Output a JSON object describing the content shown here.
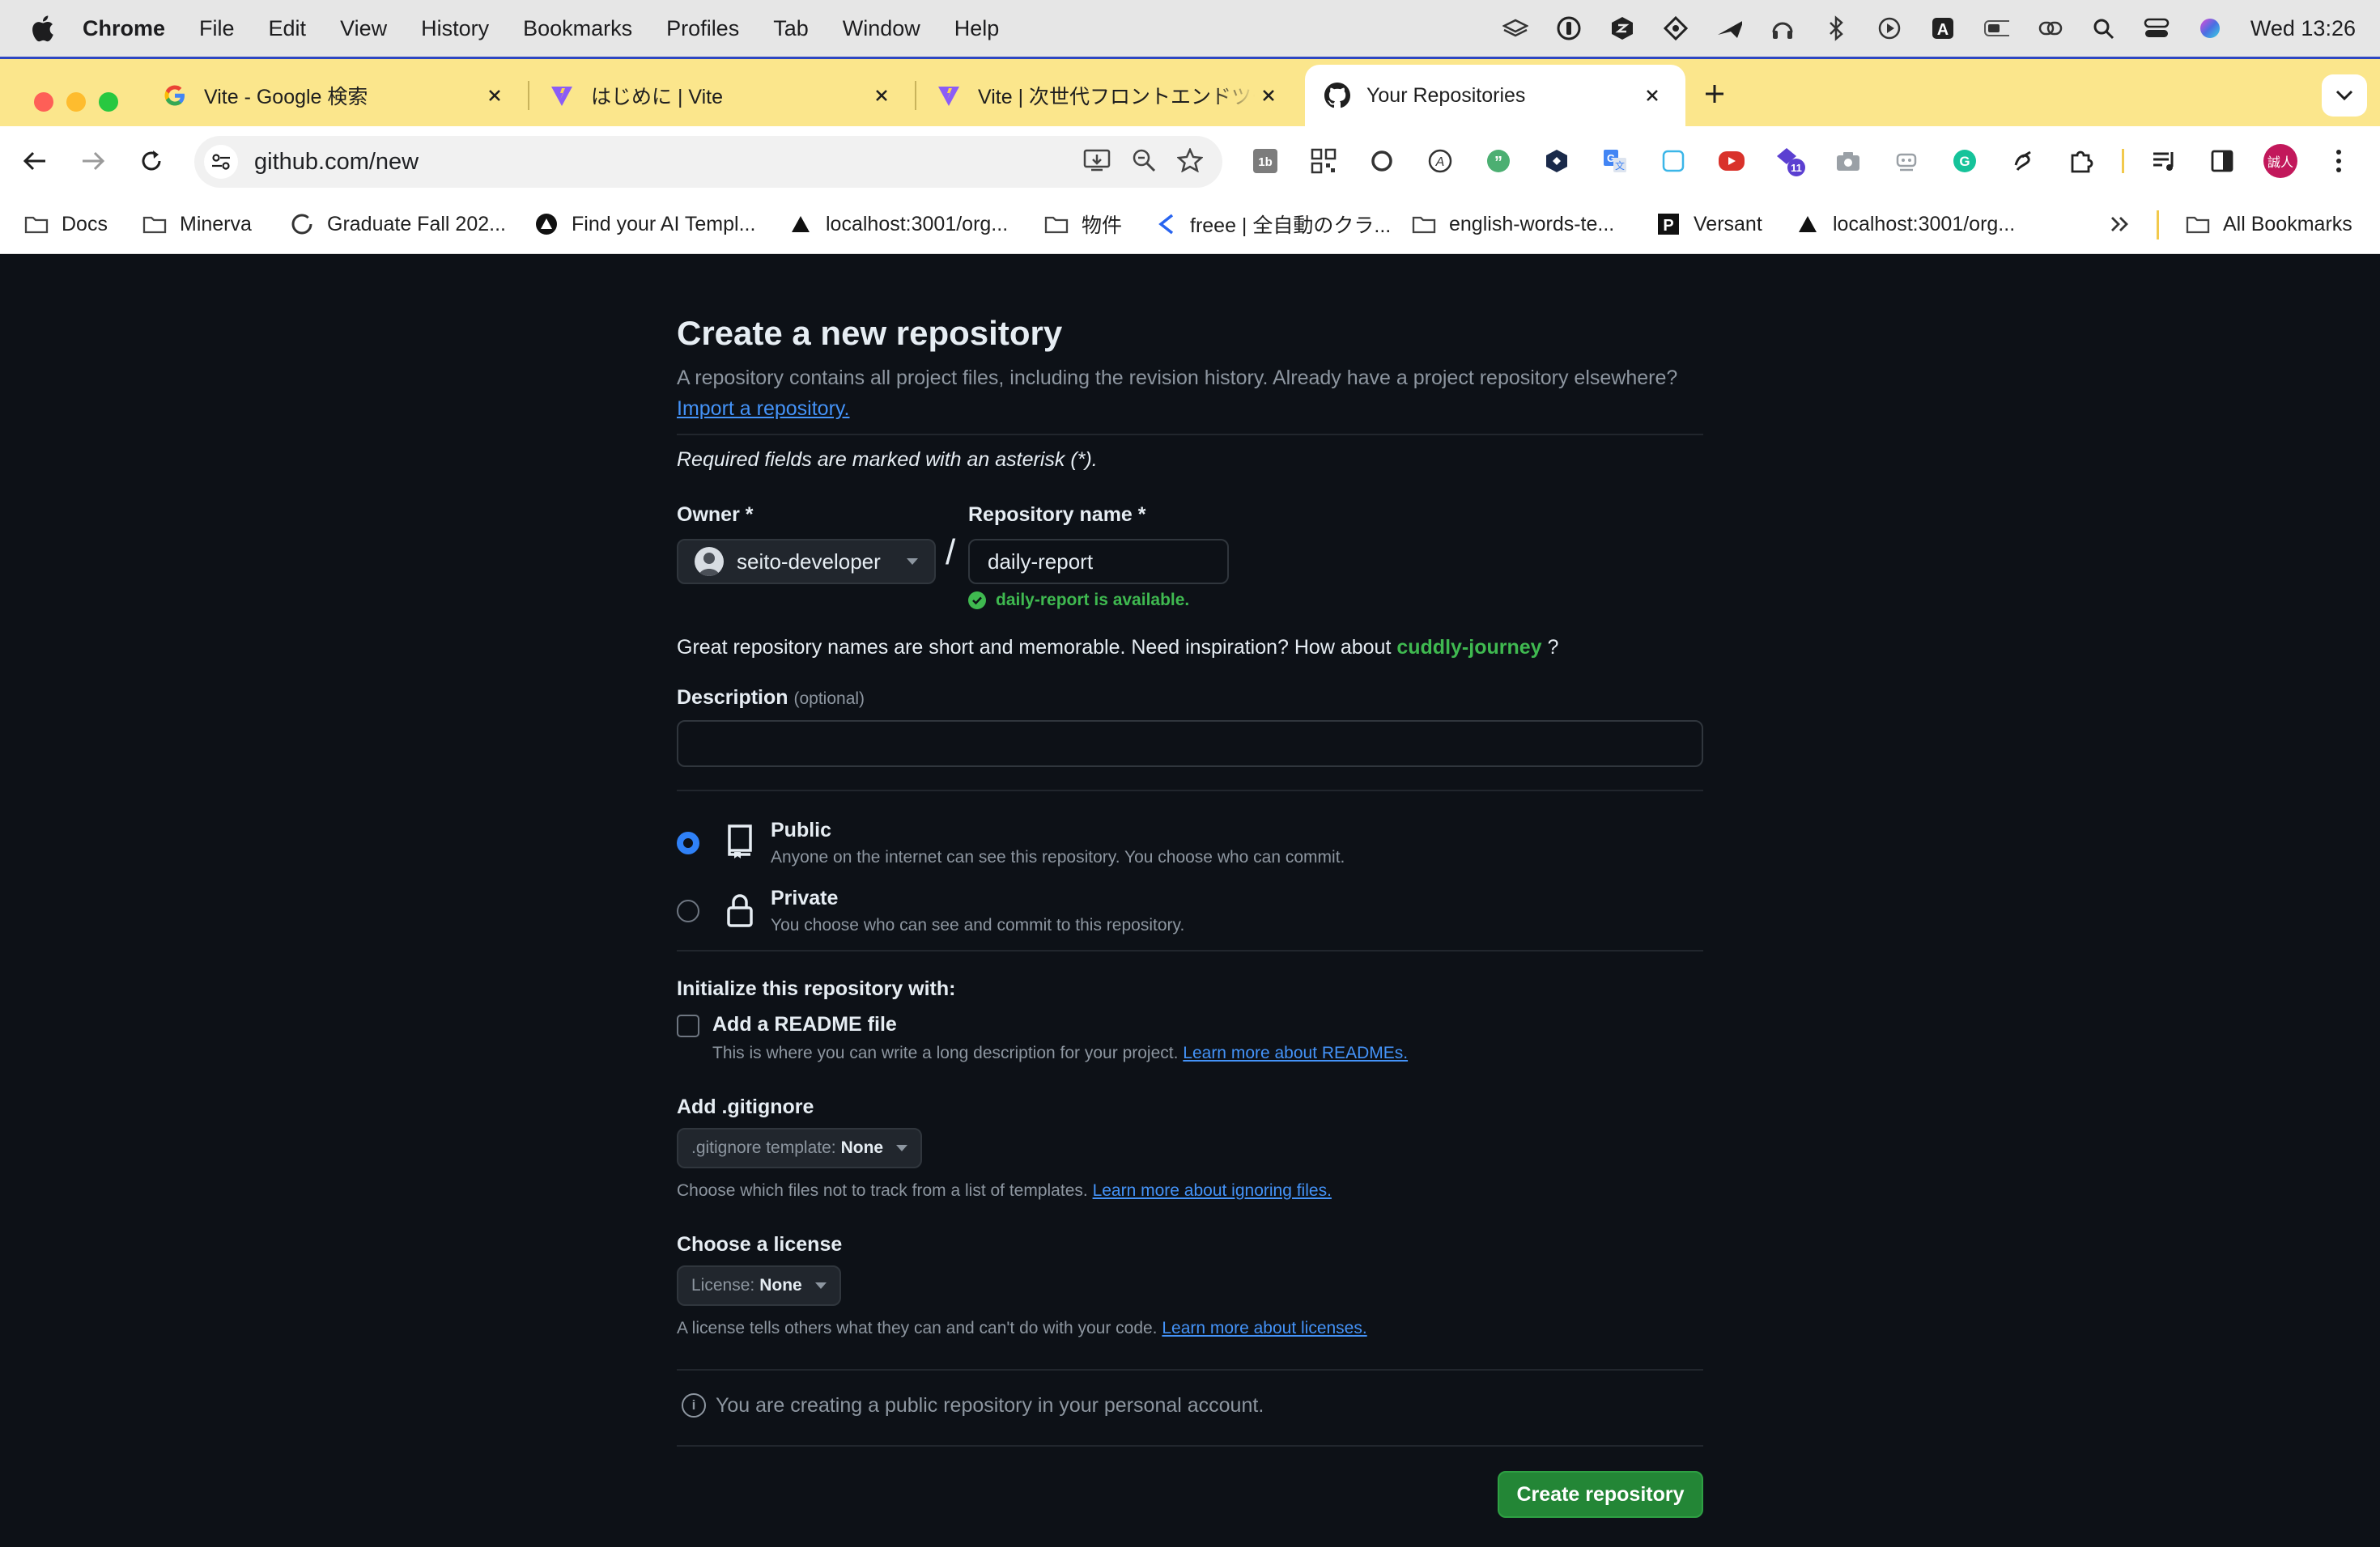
{
  "menubar": {
    "app_name": "Chrome",
    "items": [
      "File",
      "Edit",
      "View",
      "History",
      "Bookmarks",
      "Profiles",
      "Tab",
      "Window",
      "Help"
    ],
    "clock": "Wed  13:26"
  },
  "tabs": [
    {
      "title": "Vite - Google 検索",
      "icon": "google-icon"
    },
    {
      "title": "はじめに | Vite",
      "icon": "vite-icon"
    },
    {
      "title": "Vite | 次世代フロントエンドツール",
      "icon": "vite-icon"
    },
    {
      "title": "Your Repositories",
      "icon": "github-icon",
      "active": true
    }
  ],
  "toolbar": {
    "url": "github.com/new"
  },
  "bookmarks": [
    {
      "label": "Docs",
      "icon": "folder-icon"
    },
    {
      "label": "Minerva",
      "icon": "folder-icon"
    },
    {
      "label": "Graduate Fall 202...",
      "icon": "ring-icon"
    },
    {
      "label": "Find your AI Templ...",
      "icon": "triangle-circle-icon"
    },
    {
      "label": "localhost:3001/org...",
      "icon": "triangle-icon"
    },
    {
      "label": "物件",
      "icon": "folder-icon"
    },
    {
      "label": "freee | 全自動のクラ...",
      "icon": "freee-icon"
    },
    {
      "label": "english-words-te...",
      "icon": "folder-icon"
    },
    {
      "label": "Versant",
      "icon": "p-icon"
    },
    {
      "label": "localhost:3001/org...",
      "icon": "triangle-icon"
    }
  ],
  "all_bookmarks": "All Bookmarks",
  "page": {
    "title": "Create a new repository",
    "lead_text": "A repository contains all project files, including the revision history. Already have a project repository elsewhere?",
    "import_link": "Import a repository.",
    "required_note": "Required fields are marked with an asterisk (*).",
    "owner_label": "Owner *",
    "owner_value": "seito-developer",
    "slash": "/",
    "repo_label": "Repository name *",
    "repo_value": "daily-report",
    "availability": "daily-report is available.",
    "inspiration_text": "Great repository names are short and memorable. Need inspiration? How about",
    "suggestion": "cuddly-journey",
    "inspiration_end": "?",
    "description_label": "Description",
    "description_optional": "(optional)",
    "visibility": [
      {
        "title": "Public",
        "subtitle": "Anyone on the internet can see this repository. You choose who can commit.",
        "selected": true
      },
      {
        "title": "Private",
        "subtitle": "You choose who can see and commit to this repository.",
        "selected": false
      }
    ],
    "init_heading": "Initialize this repository with:",
    "readme_label": "Add a README file",
    "readme_checked": false,
    "readme_help": "This is where you can write a long description for your project.",
    "readme_link": "Learn more about READMEs.",
    "gitignore_heading": "Add .gitignore",
    "gitignore_select_label": ".gitignore template:",
    "gitignore_select_value": "None",
    "gitignore_help": "Choose which files not to track from a list of templates.",
    "gitignore_link": "Learn more about ignoring files.",
    "license_heading": "Choose a license",
    "license_select_label": "License:",
    "license_select_value": "None",
    "license_help": "A license tells others what they can and can't do with your code.",
    "license_link": "Learn more about licenses.",
    "info_note": "You are creating a public repository in your personal account.",
    "create_button": "Create repository"
  },
  "colors": {
    "page_bg": "#0d1117",
    "accent_green": "#238636",
    "link_blue": "#4493f8",
    "tabstrip": "#fbe68c"
  }
}
